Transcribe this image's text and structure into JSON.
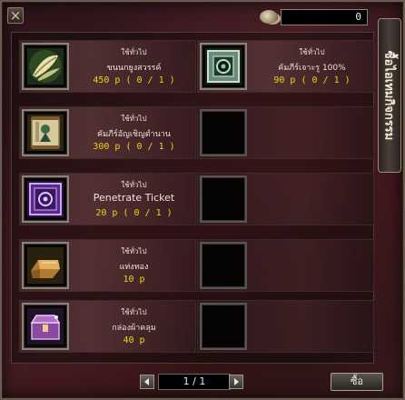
{
  "window": {
    "close_label": "×",
    "coins": "0",
    "side_tab": "ซื้อไอเทมกิจกรรม"
  },
  "items": [
    {
      "category": "ใช้ทั่วไป",
      "name": "ขนนกยูงสวรรค์",
      "price": "450 p  ( 0 / 1 )",
      "icon": "feather-icon",
      "empty": false
    },
    {
      "category": "ใช้ทั่วไป",
      "name": "คัมภีร์เจาะรู 100%",
      "price": "90 p  ( 0 / 1 )",
      "icon": "socket-scroll-icon",
      "empty": false
    },
    {
      "category": "ใช้ทั่วไป",
      "name": "คัมภีร์อัญเชิญตำนาน",
      "price": "300 p  ( 0 / 1 )",
      "icon": "summon-scroll-icon",
      "empty": false
    },
    {
      "category": "",
      "name": "",
      "price": "",
      "icon": "empty-slot",
      "empty": true
    },
    {
      "category": "ใช้ทั่วไป",
      "name": "Penetrate Ticket",
      "price": "20 p  ( 0 / 1 )",
      "icon": "penetrate-ticket-icon",
      "empty": false
    },
    {
      "category": "",
      "name": "",
      "price": "",
      "icon": "empty-slot",
      "empty": true
    },
    {
      "category": "ใช้ทั่วไป",
      "name": "แท่งทอง",
      "price": "10 p",
      "icon": "gold-bar-icon",
      "empty": false
    },
    {
      "category": "",
      "name": "",
      "price": "",
      "icon": "empty-slot",
      "empty": true
    },
    {
      "category": "ใช้ทั่วไป",
      "name": "กล่องผ้าคลุม",
      "price": "40 p",
      "icon": "cape-box-icon",
      "empty": false
    },
    {
      "category": "",
      "name": "",
      "price": "",
      "icon": "empty-slot",
      "empty": true
    }
  ],
  "pager": {
    "page": "1 / 1",
    "prev_icon": "arrow-left-icon",
    "next_icon": "arrow-right-icon"
  },
  "buy_label": "ซื้อ"
}
